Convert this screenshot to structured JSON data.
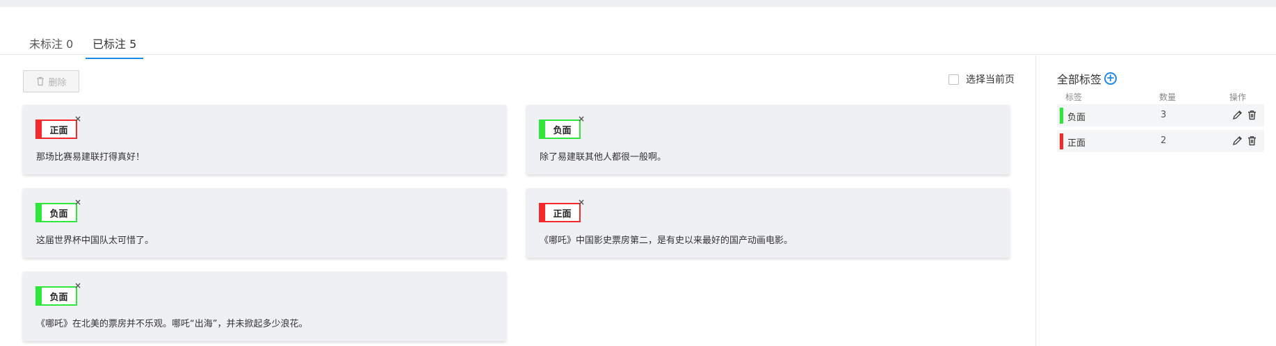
{
  "tabs": [
    {
      "label": "未标注 0",
      "active": false
    },
    {
      "label": "已标注 5",
      "active": true
    }
  ],
  "toolbar": {
    "delete_label": "删除",
    "select_page_label": "选择当前页"
  },
  "cards": [
    {
      "tag": "正面",
      "tag_type": "positive",
      "text": "那场比赛易建联打得真好！"
    },
    {
      "tag": "负面",
      "tag_type": "negative",
      "text": "除了易建联其他人都很一般啊。"
    },
    {
      "tag": "负面",
      "tag_type": "negative",
      "text": "这届世界杯中国队太可惜了。"
    },
    {
      "tag": "正面",
      "tag_type": "positive",
      "text": "《哪吒》中国影史票房第二，是有史以来最好的国产动画电影。"
    },
    {
      "tag": "负面",
      "tag_type": "negative",
      "text": "《哪吒》在北美的票房并不乐观。哪吒“出海”，并未掀起多少浪花。"
    }
  ],
  "tag_close_glyph": "×",
  "sidebar": {
    "title": "全部标签",
    "headers": {
      "label": "标签",
      "count": "数量",
      "actions": "操作"
    },
    "rows": [
      {
        "label": "负面",
        "count": "3",
        "color": "#2fe73a"
      },
      {
        "label": "正面",
        "count": "2",
        "color": "#f52929"
      }
    ]
  },
  "colors": {
    "accent": "#1e88e5",
    "positive": "#f52929",
    "negative": "#2fe73a"
  }
}
